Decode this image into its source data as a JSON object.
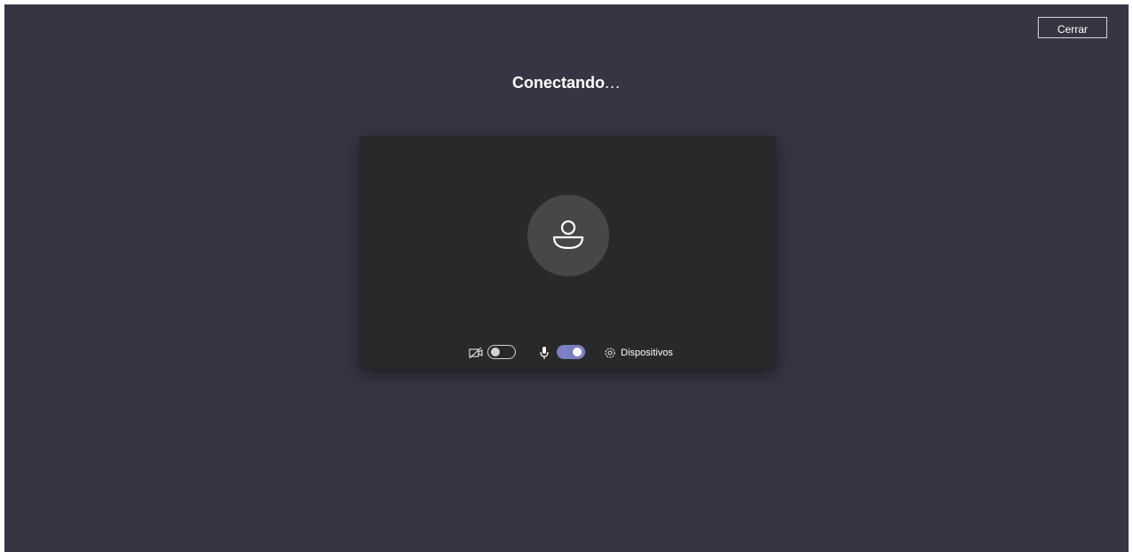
{
  "header": {
    "close_label": "Cerrar"
  },
  "status": {
    "title": "Conectando",
    "dots": "..."
  },
  "preview": {
    "avatar_icon": "person-icon",
    "camera": {
      "icon": "camera-off-icon",
      "enabled": false
    },
    "microphone": {
      "icon": "microphone-icon",
      "enabled": true
    },
    "devices": {
      "icon": "gear-icon",
      "label": "Dispositivos"
    }
  },
  "colors": {
    "background": "#363543",
    "preview_background": "#292929",
    "avatar_background": "#474747",
    "toggle_on": "#7b7fc5"
  }
}
